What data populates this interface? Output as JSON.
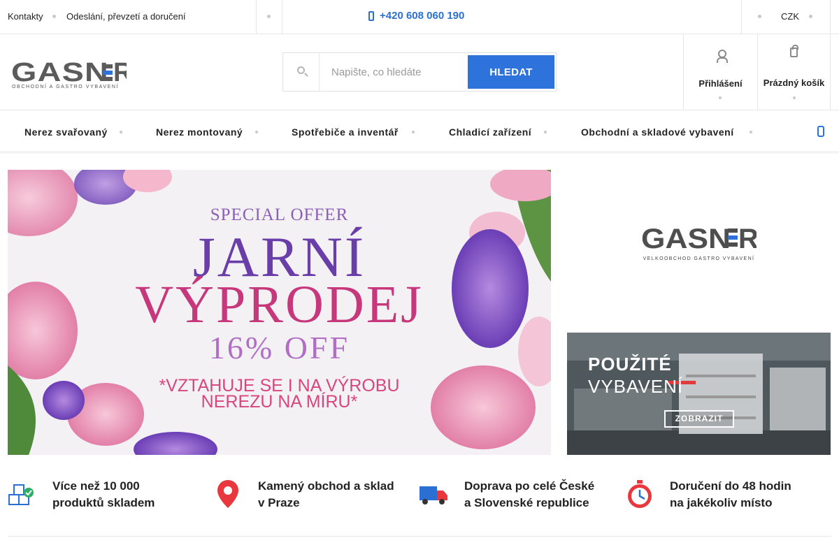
{
  "topbar": {
    "links": [
      "Kontakty",
      "Odeslání, převzetí a doručení"
    ],
    "phone": "+420 608 060 190",
    "currency": "CZK"
  },
  "header": {
    "logo_text": "GASNER",
    "logo_tagline": "OBCHODNÍ A GASTRO VYBAVENÍ",
    "search_placeholder": "Napište, co hledáte",
    "search_button": "HLEDAT",
    "login_label": "Přihlášení",
    "cart_label": "Prázdný košík"
  },
  "nav": {
    "items": [
      "Nerez svařovaný",
      "Nerez montovaný",
      "Spotřebiče a inventář",
      "Chladicí zařízení",
      "Obchodní a skladové vybavení"
    ]
  },
  "hero": {
    "special": "SPECIAL OFFER",
    "line1": "JARNÍ",
    "line2": "VÝPRODEJ",
    "discount": "16% OFF",
    "note1": "*VZTAHUJE SE I NA VÝROBU",
    "note2": "NEREZU NA MÍRU*"
  },
  "side_logo": {
    "text": "GASNER",
    "tagline": "VELKOOBCHOD GASTRO VYBAVENÍ"
  },
  "used_banner": {
    "line1": "POUŽITÉ",
    "line2": "VYBAVENÍ",
    "button": "ZOBRAZIT"
  },
  "features": [
    {
      "icon": "boxes-check-icon",
      "line1": "Více než 10 000",
      "line2": "produktů skladem"
    },
    {
      "icon": "map-pin-icon",
      "line1": "Kamený obchod a sklad",
      "line2": "v Praze"
    },
    {
      "icon": "delivery-truck-icon",
      "line1": "Doprava po celé České",
      "line2": "a Slovenské republice"
    },
    {
      "icon": "stopwatch-icon",
      "line1": "Doručení do 48 hodin",
      "line2": "na jakékoliv místo"
    }
  ],
  "colors": {
    "accent_blue": "#2e72db",
    "feature_red": "#e8383d",
    "feature_blue": "#2b6fd3"
  }
}
